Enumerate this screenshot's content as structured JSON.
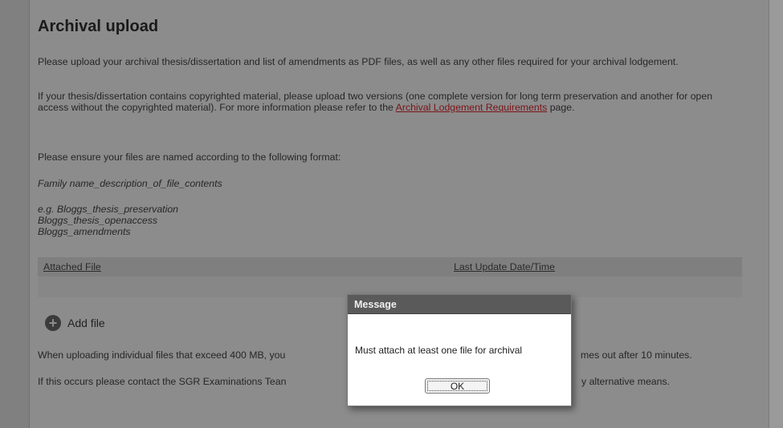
{
  "page": {
    "title": "Archival upload",
    "intro": "Please upload your archival thesis/dissertation and list of amendments as PDF files, as well as any other files required for your archival lodgement.",
    "copyright_text_1": "If your thesis/dissertation contains copyrighted material, please upload two versions (one complete version for long term preservation and another for open access without the copyrighted material). For more information please refer to the ",
    "copyright_link": "Archival Lodgement Requirements",
    "copyright_text_2": " page.",
    "naming_intro": "Please ensure your files are named according to the following format:",
    "naming_format": "Family name_description_of_file_contents",
    "examples": [
      "e.g. Bloggs_thesis_preservation",
      "Bloggs_thesis_openaccess",
      "Bloggs_amendments"
    ]
  },
  "table": {
    "col_file": "Attached File",
    "col_date": "Last Update Date/Time"
  },
  "add_file_label": "Add file",
  "notes": {
    "upload_left": "When uploading individual files that exceed 400 MB, you",
    "upload_right": "mes out after 10 minutes.",
    "contact_left": "If this occurs please contact the SGR Examinations Tean",
    "contact_right": "y alternative means."
  },
  "dialog": {
    "title": "Message",
    "message": "Must attach at least one file for archival",
    "ok_label": "OK"
  },
  "colors": {
    "link": "#7a1418",
    "overlay_bg": "#808080",
    "dialog_title_bg": "#5a5a5a"
  }
}
